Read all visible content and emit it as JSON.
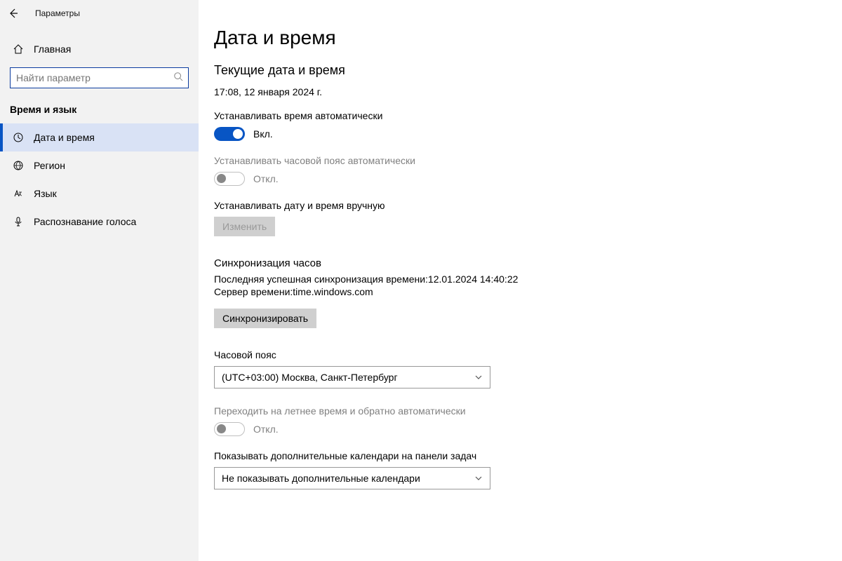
{
  "sidebar": {
    "top_title": "Параметры",
    "home_label": "Главная",
    "search_placeholder": "Найти параметр",
    "section_title": "Время и язык",
    "items": [
      {
        "label": "Дата и время"
      },
      {
        "label": "Регион"
      },
      {
        "label": "Язык"
      },
      {
        "label": "Распознавание голоса"
      }
    ]
  },
  "main": {
    "title": "Дата и время",
    "current_heading": "Текущие дата и время",
    "current_value": "17:08, 12 января 2024 г.",
    "auto_time_label": "Устанавливать время автоматически",
    "on_label": "Вкл.",
    "auto_tz_label": "Устанавливать часовой пояс автоматически",
    "off_label": "Откл.",
    "manual_label": "Устанавливать дату и время вручную",
    "change_btn": "Изменить",
    "sync_heading": "Синхронизация часов",
    "sync_last": "Последняя успешная синхронизация времени:12.01.2024 14:40:22",
    "sync_server": "Сервер времени:time.windows.com",
    "sync_btn": "Синхронизировать",
    "tz_label": "Часовой пояс",
    "tz_value": "(UTC+03:00) Москва, Санкт-Петербург",
    "dst_label": "Переходить на летнее время и обратно автоматически",
    "calendars_label": "Показывать дополнительные календари на панели задач",
    "calendars_value": "Не показывать дополнительные календари"
  }
}
